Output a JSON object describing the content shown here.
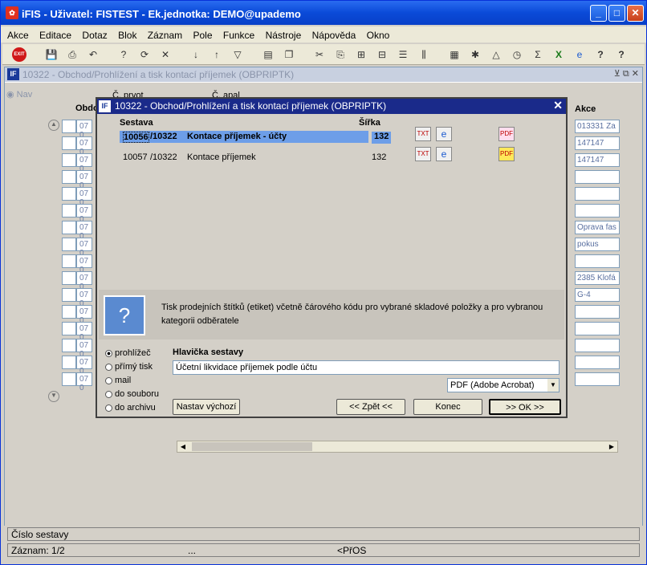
{
  "app": {
    "title": "iFIS - Uživatel: FISTEST - Ek.jednotka: DEMO@upademo",
    "icon": "ifis-app-icon"
  },
  "window_buttons": [
    "minimize",
    "maximize",
    "close"
  ],
  "menu": [
    "Akce",
    "Editace",
    "Dotaz",
    "Blok",
    "Záznam",
    "Pole",
    "Funkce",
    "Nástroje",
    "Nápověda",
    "Okno"
  ],
  "toolbar": {
    "exit": "EXIT"
  },
  "mdi": {
    "title": "10322 - Obchod/Prohlížení a tisk kontací příjemek (OBPRIPTK)",
    "nav": "Nav"
  },
  "bg_table": {
    "hdr_obdobi": "Obdo",
    "hdr_cprvot": "Č. prvot",
    "hdr_capal": "Č. apal",
    "hdr_akce": "Akce",
    "row_prefix": "07 0",
    "akce": [
      "013331 Za",
      "147147",
      "147147",
      "",
      "",
      "",
      "Oprava fas",
      "pokus",
      "",
      "2385 Klofá",
      "G-4",
      "",
      "",
      "",
      "",
      ""
    ]
  },
  "dialog": {
    "title": "10322 - Obchod/Prohlížení a tisk kontací příjemek (OBPRIPTK)",
    "col_sestava": "Sestava",
    "col_sirka": "Šířka",
    "rows": [
      {
        "code": "10056",
        "num": "/10322",
        "name": "Kontace příjemek - účty",
        "width": "132"
      },
      {
        "code": "10057",
        "num": "/10322",
        "name": "Kontace příjemek",
        "width": "132"
      }
    ],
    "description": "Tisk prodejních štítků (etiket) včetně čárového kódu pro vybrané skladové položky a pro vybranou kategorii odběratele",
    "outputs": [
      "prohlížeč",
      "přímý tisk",
      "mail",
      "do souboru",
      "do archivu"
    ],
    "selected_output": "prohlížeč",
    "header_label": "Hlavička sestavy",
    "header_value": "Účetní likvidace příjemek podle účtu",
    "format_value": "PDF (Adobe Acrobat)",
    "btn_default": "Nastav výchozí",
    "btn_back": "<< Zpět <<",
    "btn_end": "Konec",
    "btn_ok": ">> OK >>"
  },
  "status": {
    "field": "Číslo sestavy",
    "record": "Záznam: 1/2",
    "dots": "...",
    "mode": "<PřOS"
  }
}
